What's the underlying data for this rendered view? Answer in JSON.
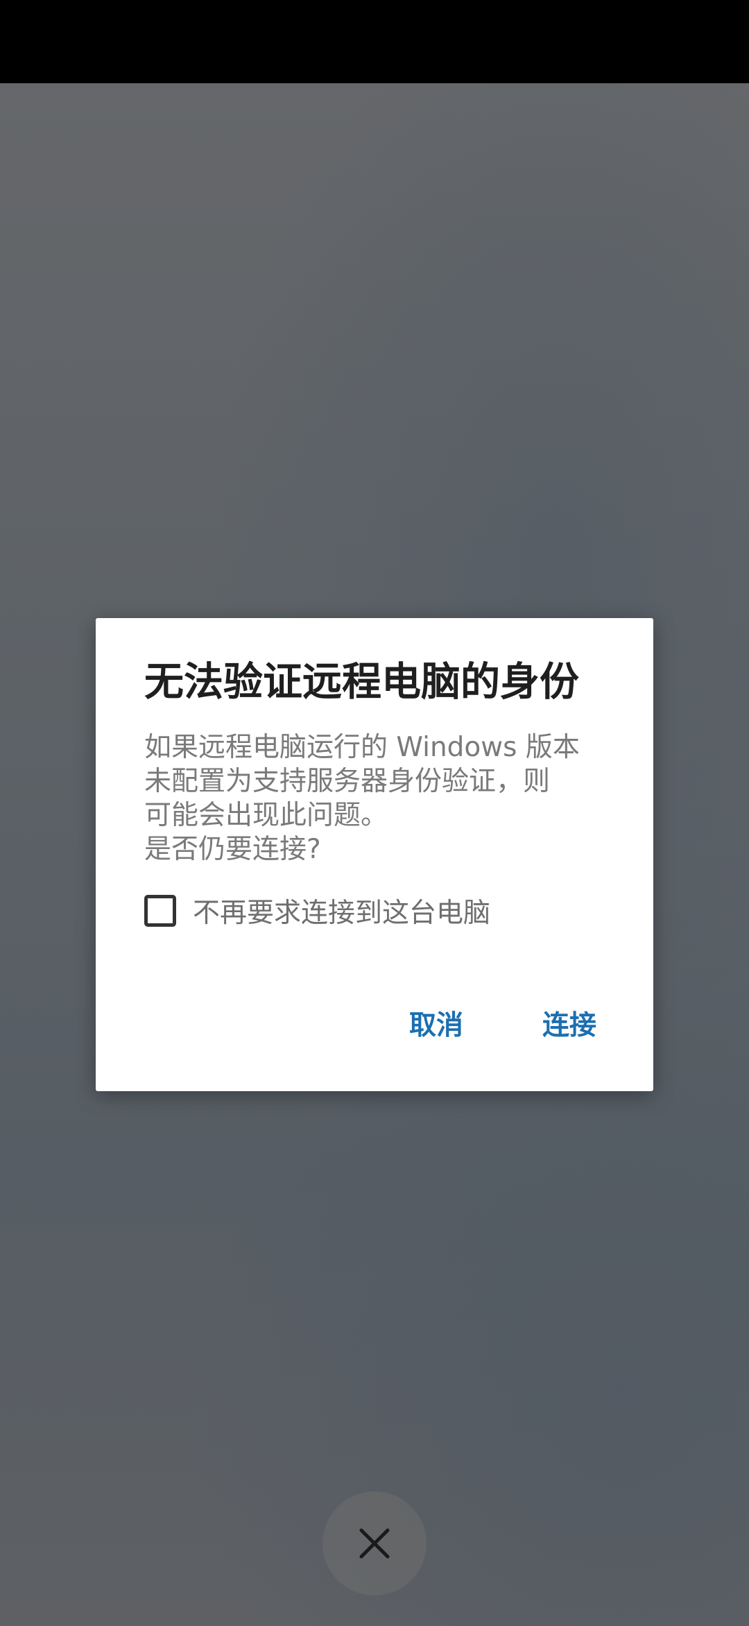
{
  "dialog": {
    "title": "无法验证远程电脑的身份",
    "body_lines": [
      "如果远程电脑运行的 Windows 版本",
      "未配置为支持服务器身份验证，则",
      "可能会出现此问题。",
      "是否仍要连接?"
    ],
    "checkbox_label": "不再要求连接到这台电脑",
    "checkbox_checked": false,
    "cancel_label": "取消",
    "connect_label": "连接"
  },
  "colors": {
    "accent": "#1b6fb0",
    "title": "#1f1f1f",
    "body": "#7a7a7a"
  },
  "icons": {
    "close": "close-icon"
  }
}
